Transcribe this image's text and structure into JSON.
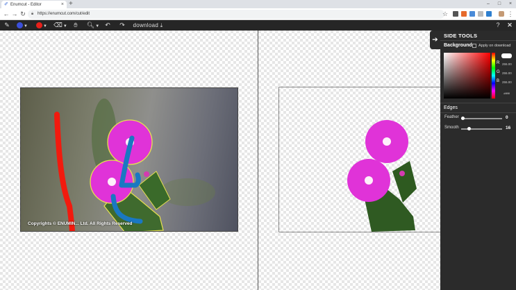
{
  "browser": {
    "tab_title": "Enumcut - Editor",
    "tab_close": "×",
    "new_tab": "+",
    "url": "https://enumcut.com/cut/edit",
    "window_controls": [
      "–",
      "□",
      "×"
    ]
  },
  "toolbar": {
    "download_label": "download",
    "brush_color": "#3b4fd9",
    "marker_color": "#e8201a"
  },
  "canvas": {
    "copyright": "Copyrights © ENUMIN... Ltd. All Rights Reserved"
  },
  "side_panel": {
    "title": "SIDE TOOLS",
    "background_label": "Background",
    "apply_label": "Apply on download",
    "rgb": [
      {
        "label": "R",
        "value": "255.00"
      },
      {
        "label": "G",
        "value": "255.00"
      },
      {
        "label": "B",
        "value": "255.00"
      }
    ],
    "hex": "#ffffff",
    "swatch_color": "#ffffff",
    "edges_label": "Edges",
    "sliders": [
      {
        "label": "Feather",
        "value": "0",
        "level": 0
      },
      {
        "label": "Smooth",
        "value": "16",
        "level": 0.16
      }
    ]
  }
}
